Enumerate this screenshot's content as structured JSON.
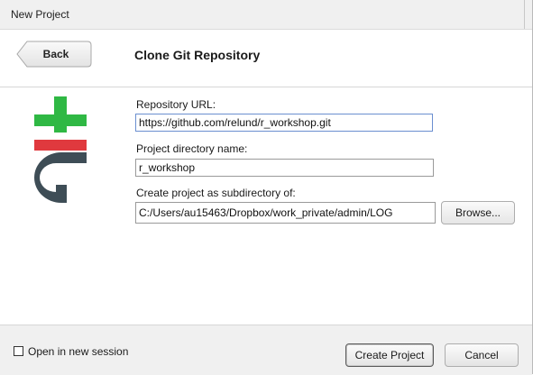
{
  "window": {
    "title": "New Project"
  },
  "header": {
    "back_label": "Back",
    "heading": "Clone Git Repository"
  },
  "form": {
    "repo_url_label": "Repository URL:",
    "repo_url_value": "https://github.com/relund/r_workshop.git",
    "dir_name_label": "Project directory name:",
    "dir_name_value": "r_workshop",
    "subdir_label": "Create project as subdirectory of:",
    "subdir_value": "C:/Users/au15463/Dropbox/work_private/admin/LOG",
    "browse_label": "Browse..."
  },
  "footer": {
    "new_session_label": "Open in new session",
    "new_session_checked": false,
    "create_label": "Create Project",
    "cancel_label": "Cancel"
  },
  "colors": {
    "git_green": "#2fb844",
    "git_red": "#e0393e",
    "git_gray": "#3e4d56"
  },
  "icons": {
    "logo": "git-logo-icon"
  }
}
